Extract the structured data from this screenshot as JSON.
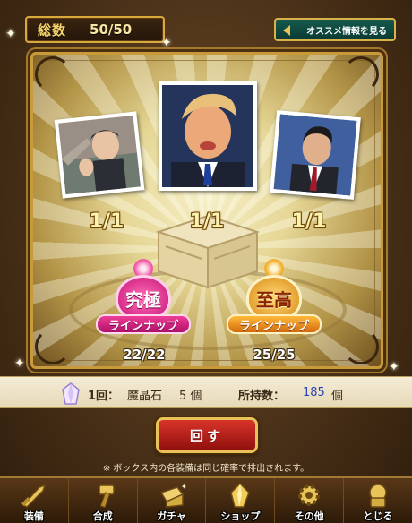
{
  "header": {
    "total_label": "総数",
    "total_value": "50/50",
    "recommend_label": "オススメ情報を見る"
  },
  "prizes": [
    {
      "count": "1/1"
    },
    {
      "count": "1/1"
    },
    {
      "count": "1/1"
    }
  ],
  "lineups": {
    "ultimate": {
      "title": "究極",
      "subtitle": "ラインナップ",
      "count": "22/22"
    },
    "supreme": {
      "title": "至高",
      "subtitle": "ラインナップ",
      "count": "25/25"
    }
  },
  "cost": {
    "label": "1回：",
    "item": "魔晶石",
    "quantity": "5 個",
    "owned_label": "所持数：",
    "owned_value": "185",
    "owned_unit": "個"
  },
  "spin_button": {
    "label": "回す"
  },
  "note": "※ ボックス内の各装備は同じ確率で排出されます。",
  "nav": [
    {
      "label": "装備",
      "icon": "sword-icon"
    },
    {
      "label": "合成",
      "icon": "hammer-icon"
    },
    {
      "label": "ガチャ",
      "icon": "gacha-icon"
    },
    {
      "label": "ショップ",
      "icon": "crystal-icon"
    },
    {
      "label": "その他",
      "icon": "gear-icon"
    },
    {
      "label": "とじる",
      "icon": "close-icon"
    }
  ],
  "colors": {
    "accent_gold": "#d9a93c",
    "owned_value": "#2b3fb5",
    "spin_red": "#c2231c",
    "ultimate_pink": "#e0288a",
    "supreme_orange": "#e58a12"
  }
}
